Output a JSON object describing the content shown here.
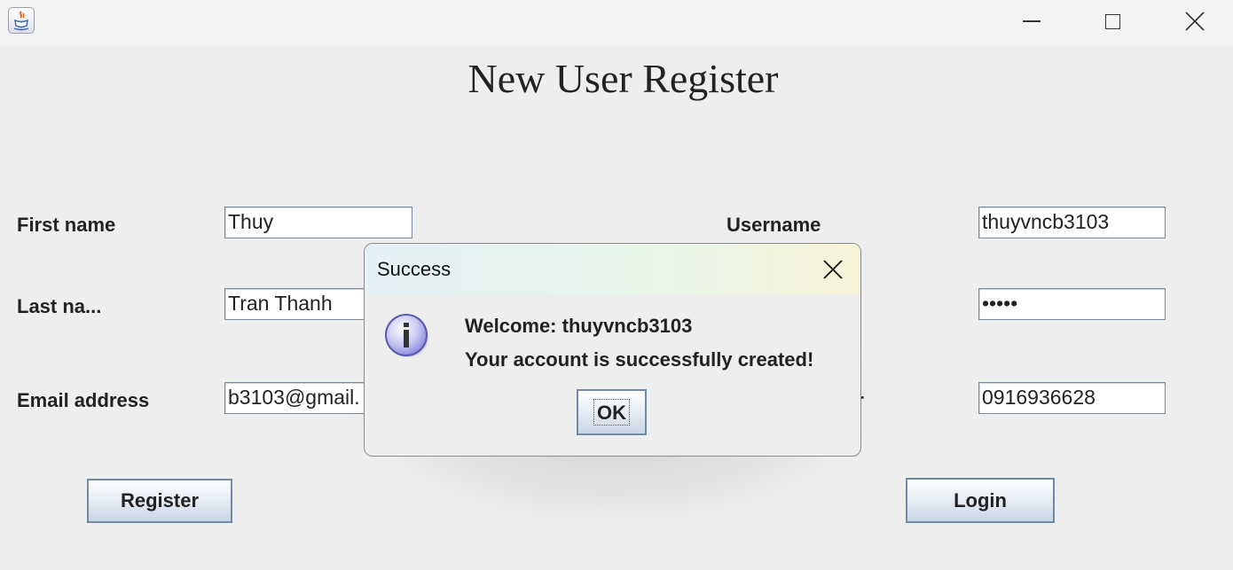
{
  "window": {
    "icon": "java-icon"
  },
  "form": {
    "title": "New User Register",
    "first_name_label": "First name",
    "first_name_value": "Thuy",
    "last_name_label": "Last na...",
    "last_name_value": "Tran Thanh",
    "email_label": "Email address",
    "email_value": "b3103@gmail.",
    "username_label": "Username",
    "username_value": "thuyvncb3103",
    "password_value": "•••••",
    "phone_label_partial": "er",
    "phone_value": "0916936628",
    "register_label": "Register",
    "login_label": "Login"
  },
  "dialog": {
    "title": "Success",
    "icon": "info-icon",
    "line1": "Welcome: thuyvncb3103",
    "line2": "Your account is successfully created!",
    "ok_label": "OK"
  }
}
